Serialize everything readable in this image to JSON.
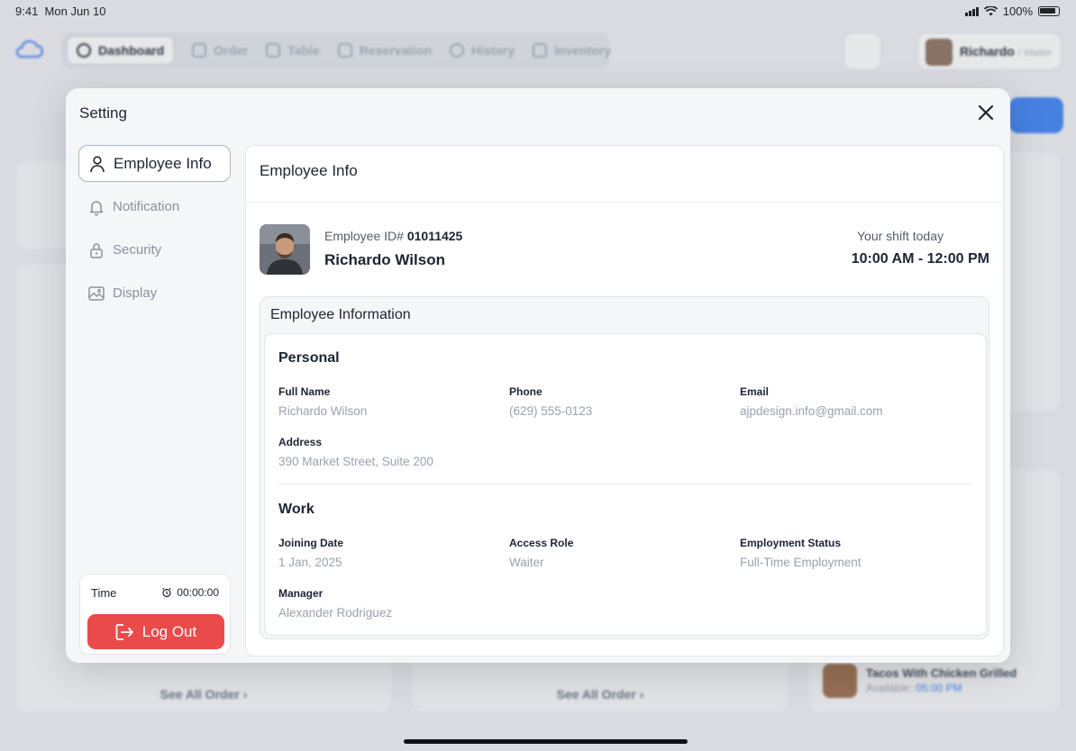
{
  "status_bar": {
    "time": "9:41",
    "date": "Mon Jun 10",
    "battery": "100%"
  },
  "background": {
    "nav": [
      {
        "label": "Dashboard",
        "active": true
      },
      {
        "label": "Order"
      },
      {
        "label": "Table"
      },
      {
        "label": "Reservation"
      },
      {
        "label": "History"
      },
      {
        "label": "Inventory"
      }
    ],
    "profile_name": "Richardo",
    "profile_role": "Waiter",
    "see_all_label": "See All Order",
    "menu_item_name": "Tacos With Chicken Grilled",
    "menu_item_available_label": "Available:",
    "menu_item_available_time": "05:00 PM"
  },
  "modal": {
    "title": "Setting",
    "menu": [
      {
        "label": "Employee Info",
        "icon": "user-icon",
        "active": true
      },
      {
        "label": "Notification",
        "icon": "bell-icon"
      },
      {
        "label": "Security",
        "icon": "lock-icon"
      },
      {
        "label": "Display",
        "icon": "image-icon"
      }
    ],
    "time_label": "Time",
    "time_value": "00:00:00",
    "logout_label": "Log Out",
    "content_title": "Employee Info",
    "employee": {
      "id_label": "Employee ID#",
      "id": "01011425",
      "name": "Richardo Wilson",
      "shift_label": "Your shift today",
      "shift": "10:00 AM - 12:00 PM"
    },
    "info_title": "Employee Information",
    "personal_title": "Personal",
    "personal": {
      "full_name_label": "Full Name",
      "full_name": "Richardo Wilson",
      "phone_label": "Phone",
      "phone": "(629) 555-0123",
      "email_label": "Email",
      "email": "ajpdesign.info@gmail.com",
      "address_label": "Address",
      "address": "390 Market Street, Suite 200"
    },
    "work_title": "Work",
    "work": {
      "joining_label": "Joining Date",
      "joining": "1 Jan, 2025",
      "role_label": "Access Role",
      "role": "Waiter",
      "status_label": "Employment Status",
      "status": "Full-Time Employment",
      "manager_label": "Manager",
      "manager": "Alexander Rodriguez"
    }
  },
  "colors": {
    "accent_red": "#ea4a4a",
    "accent_blue": "#3b82f6"
  }
}
